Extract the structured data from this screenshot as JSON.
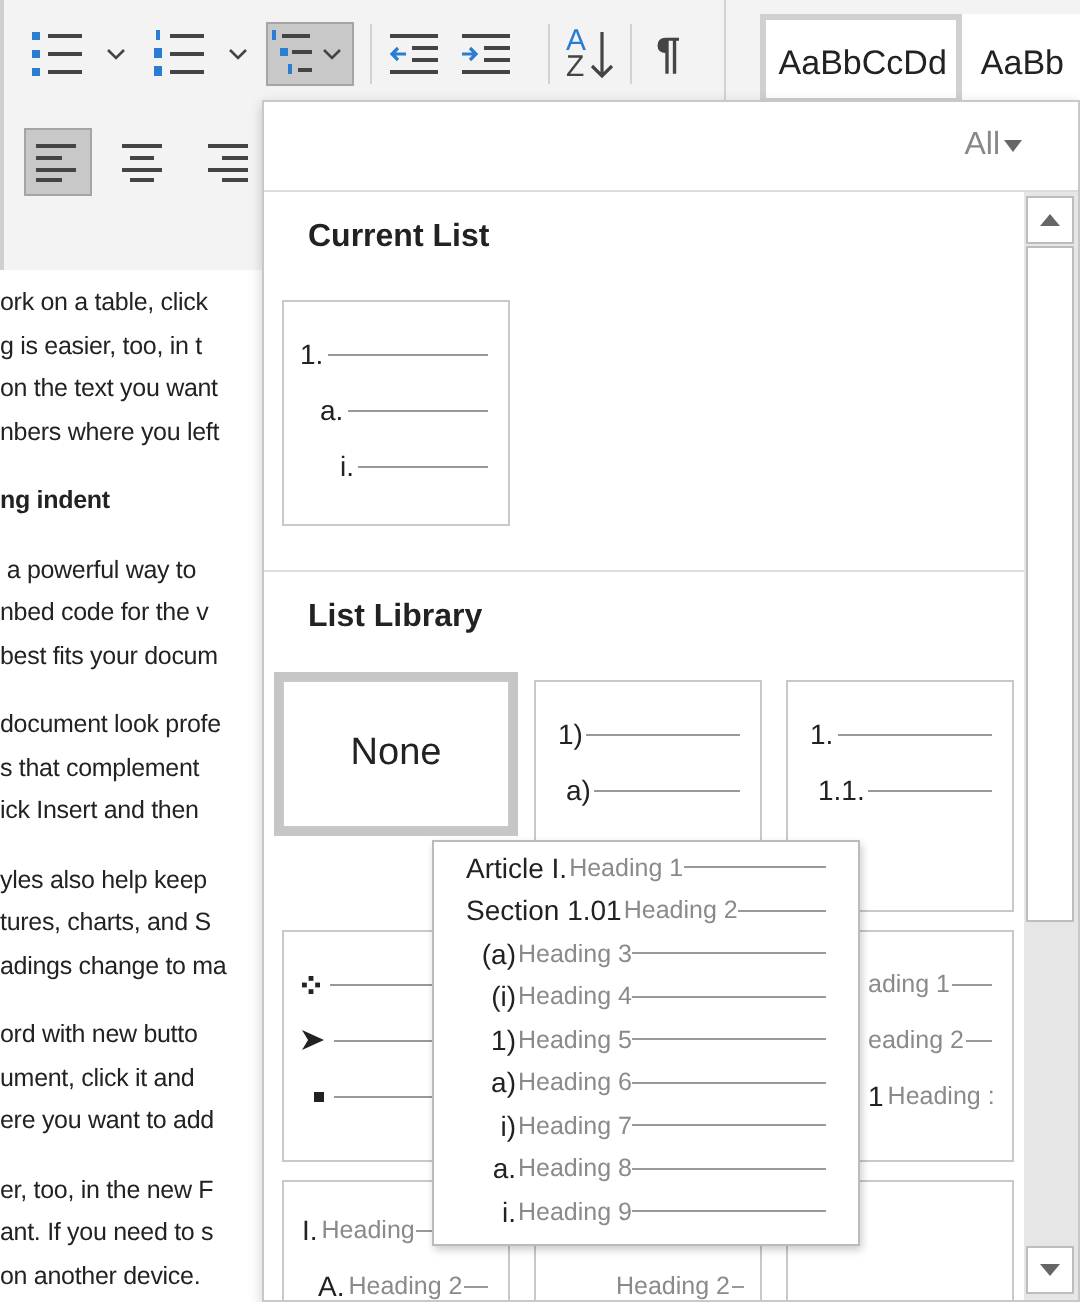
{
  "ribbon": {
    "multilevel_selected": true,
    "sort_letters": [
      "A",
      "Z"
    ],
    "pilcrow": "¶",
    "styles": [
      {
        "label": "AaBbCcDd",
        "selected": true
      },
      {
        "label": "AaBb",
        "selected": false
      }
    ],
    "align": [
      {
        "kind": "left",
        "selected": true
      },
      {
        "kind": "center",
        "selected": false
      },
      {
        "kind": "right",
        "selected": false
      }
    ]
  },
  "document": {
    "paragraphs": [
      {
        "kind": "body",
        "lines": [
          "ork on a table, click",
          "g is easier, too, in t",
          "on the text you want",
          "nbers where you left"
        ]
      },
      {
        "kind": "heading",
        "lines": [
          "ng indent"
        ]
      },
      {
        "kind": "body",
        "lines": [
          " a powerful way to",
          "nbed code for the v",
          "best fits your docum"
        ]
      },
      {
        "kind": "body",
        "lines": [
          "document look profe",
          "s that complement",
          "ick Insert and then"
        ]
      },
      {
        "kind": "body",
        "lines": [
          "yles also help keep",
          "tures, charts, and S",
          "adings change to ma"
        ]
      },
      {
        "kind": "body",
        "lines": [
          "ord with new butto",
          "ument, click it and",
          "ere you want to add"
        ]
      },
      {
        "kind": "body",
        "lines": [
          "er, too, in the new F",
          "ant. If you need to s",
          "on another device."
        ]
      }
    ]
  },
  "panel": {
    "filter": "All",
    "current": {
      "title": "Current List",
      "tiles": [
        {
          "kind": "list",
          "selected": false,
          "lines": [
            {
              "marker": "1."
            },
            {
              "marker": "a."
            },
            {
              "marker": "i."
            }
          ]
        }
      ]
    },
    "library": {
      "title": "List Library",
      "tiles": [
        {
          "kind": "none",
          "selected": true,
          "label": "None"
        },
        {
          "kind": "list",
          "selected": false,
          "lines": [
            {
              "marker": "1)"
            },
            {
              "marker": "a)"
            }
          ]
        },
        {
          "kind": "list",
          "selected": false,
          "lines": [
            {
              "marker": "1."
            },
            {
              "marker": "1.1."
            }
          ]
        },
        {
          "kind": "bullets",
          "selected": false
        },
        {
          "kind": "clipped",
          "selected": false,
          "lines": [
            {
              "text": "ading 1"
            },
            {
              "text": "eading 2"
            },
            {
              "marker": "1",
              "text": "Heading :"
            }
          ]
        },
        {
          "kind": "headings",
          "selected": false,
          "lines": [
            {
              "marker": "I.",
              "text": "Heading"
            },
            {
              "marker": "A.",
              "text": "Heading 2"
            }
          ]
        },
        {
          "kind": "lower",
          "selected": false,
          "lines": [
            {
              "text": "Heading 2"
            }
          ]
        },
        {
          "kind": "covered"
        }
      ]
    },
    "tooltip": [
      {
        "kind": "heading",
        "marker": "Article I.",
        "text": "Heading 1"
      },
      {
        "kind": "heading",
        "marker": "Section 1.01",
        "text": "Heading 2"
      },
      {
        "kind": "level",
        "marker": "(a)",
        "text": "Heading 3"
      },
      {
        "kind": "level",
        "marker": "(i)",
        "text": "Heading 4"
      },
      {
        "kind": "level",
        "marker": "1)",
        "text": "Heading 5"
      },
      {
        "kind": "level",
        "marker": "a)",
        "text": "Heading 6"
      },
      {
        "kind": "level",
        "marker": "i)",
        "text": "Heading 7"
      },
      {
        "kind": "level",
        "marker": "a.",
        "text": "Heading 8"
      },
      {
        "kind": "level",
        "marker": "i.",
        "text": "Heading 9"
      }
    ]
  }
}
